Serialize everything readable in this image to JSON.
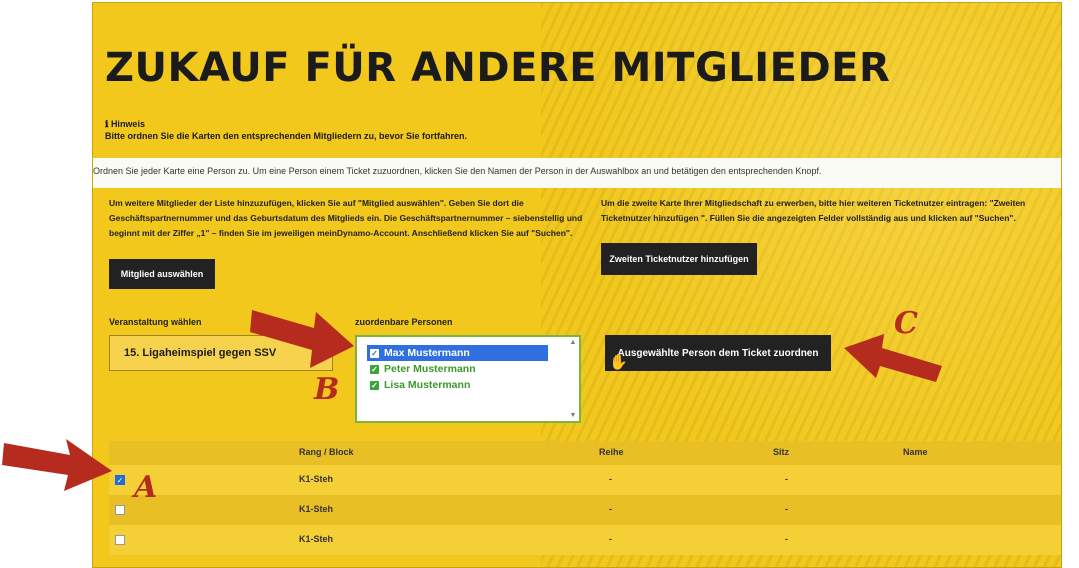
{
  "page": {
    "title": "ZUKAUF FÜR ANDERE MITGLIEDER",
    "hint_label": "Hinweis",
    "hint_icon": "info-icon",
    "hint_text": "Bitte ordnen Sie die Karten den entsprechenden Mitgliedern zu, bevor Sie fortfahren.",
    "info_bar": "Ordnen Sie jeder Karte eine Person zu. Um eine Person einem Ticket zuzuordnen, klicken Sie den Namen der Person in der Auswahlbox an und betätigen den entsprechenden Knopf."
  },
  "left_column": {
    "text_lines": [
      "Um weitere Mitglieder der Liste hinzuzufügen, klicken Sie auf \"Mitglied auswählen\". Geben Sie dort die",
      "Geschäftspartnernummer und das Geburtsdatum des Mitglieds ein. Die Geschäftspartnernummer – siebenstellig und",
      "beginnt mit der Ziffer „1\" – finden Sie im jeweiligen meinDynamo-Account. Anschließend klicken Sie auf \"Suchen\"."
    ],
    "button": "Mitglied auswählen"
  },
  "right_column": {
    "text_lines": [
      "Um die zweite Karte Ihrer Mitgliedschaft zu erwerben, bitte hier weiteren Ticketnutzer eintragen: \"Zweiten",
      "Ticketnutzer hinzufügen \". Füllen Sie die angezeigten Felder vollständig aus und klicken auf \"Suchen\"."
    ],
    "button": "Zweiten Ticketnutzer hinzufügen"
  },
  "event": {
    "label": "Veranstaltung wählen",
    "selected": "15. Ligaheimspiel gegen SSV"
  },
  "persons": {
    "label": "zuordenbare Personen",
    "items": [
      {
        "name": "Max Mustermann",
        "selected": true
      },
      {
        "name": "Peter Mustermann",
        "selected": false
      },
      {
        "name": "Lisa Mustermann",
        "selected": false
      }
    ]
  },
  "assign_button": "Ausgewählte Person dem Ticket zuordnen",
  "table": {
    "headers": [
      "Rang / Block",
      "Reihe",
      "Sitz",
      "Name"
    ],
    "rows": [
      {
        "checked": true,
        "block": "K1-Steh",
        "reihe": "-",
        "sitz": "-",
        "name": ""
      },
      {
        "checked": false,
        "block": "K1-Steh",
        "reihe": "-",
        "sitz": "-",
        "name": ""
      },
      {
        "checked": false,
        "block": "K1-Steh",
        "reihe": "-",
        "sitz": "-",
        "name": ""
      }
    ]
  },
  "annotations": {
    "a": "A",
    "b": "B",
    "c": "C",
    "arrow_color": "#b52b1e"
  }
}
